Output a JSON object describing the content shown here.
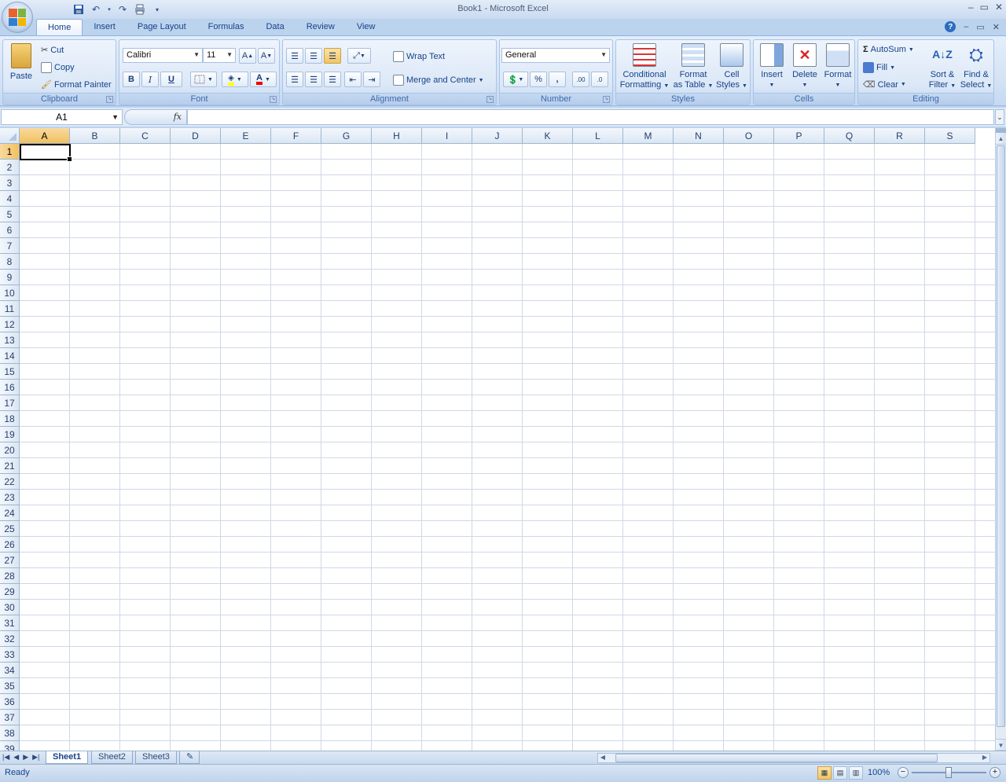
{
  "window": {
    "title": "Book1 - Microsoft Excel",
    "controls": [
      "–",
      "▭",
      "✕"
    ]
  },
  "quick_access": {
    "icons": [
      "save-icon",
      "undo-icon",
      "redo-icon",
      "print-icon",
      "customize-icon"
    ]
  },
  "tabs": [
    "Home",
    "Insert",
    "Page Layout",
    "Formulas",
    "Data",
    "Review",
    "View"
  ],
  "active_tab": "Home",
  "ribbon": {
    "clipboard": {
      "label": "Clipboard",
      "paste": "Paste",
      "cut": "Cut",
      "copy": "Copy",
      "format_painter": "Format Painter"
    },
    "font": {
      "label": "Font",
      "font_name": "Calibri",
      "font_size": "11",
      "bold": "B",
      "italic": "I",
      "underline": "U"
    },
    "alignment": {
      "label": "Alignment",
      "wrap_text": "Wrap Text",
      "merge_center": "Merge and Center"
    },
    "number": {
      "label": "Number",
      "format": "General",
      "percent": "%",
      "comma": ","
    },
    "styles": {
      "label": "Styles",
      "conditional_1": "Conditional",
      "conditional_2": "Formatting",
      "format_table_1": "Format",
      "format_table_2": "as Table",
      "cell_styles_1": "Cell",
      "cell_styles_2": "Styles"
    },
    "cells": {
      "label": "Cells",
      "insert": "Insert",
      "delete": "Delete",
      "format": "Format"
    },
    "editing": {
      "label": "Editing",
      "autosum": "AutoSum",
      "fill": "Fill",
      "clear": "Clear",
      "sort_1": "Sort &",
      "sort_2": "Filter",
      "find_1": "Find &",
      "find_2": "Select"
    }
  },
  "formula_bar": {
    "name_box": "A1",
    "fx": "fx",
    "value": ""
  },
  "columns": [
    "A",
    "B",
    "C",
    "D",
    "E",
    "F",
    "G",
    "H",
    "I",
    "J",
    "K",
    "L",
    "M",
    "N",
    "O",
    "P",
    "Q",
    "R",
    "S"
  ],
  "rows": [
    "1",
    "2",
    "3",
    "4",
    "5",
    "6",
    "7",
    "8",
    "9",
    "10",
    "11",
    "12",
    "13",
    "14",
    "15",
    "16",
    "17",
    "18",
    "19",
    "20",
    "21",
    "22",
    "23",
    "24",
    "25",
    "26",
    "27",
    "28",
    "29",
    "30",
    "31",
    "32",
    "33",
    "34",
    "35",
    "36",
    "37",
    "38",
    "39"
  ],
  "sheets": [
    "Sheet1",
    "Sheet2",
    "Sheet3"
  ],
  "active_sheet": "Sheet1",
  "status": {
    "text": "Ready",
    "zoom": "100%"
  },
  "colors": {
    "accent": "#15428b",
    "ribbon_bg": "#d5e3f5",
    "selected_header": "#f1c15f",
    "grid_line": "#d0d7e5"
  }
}
